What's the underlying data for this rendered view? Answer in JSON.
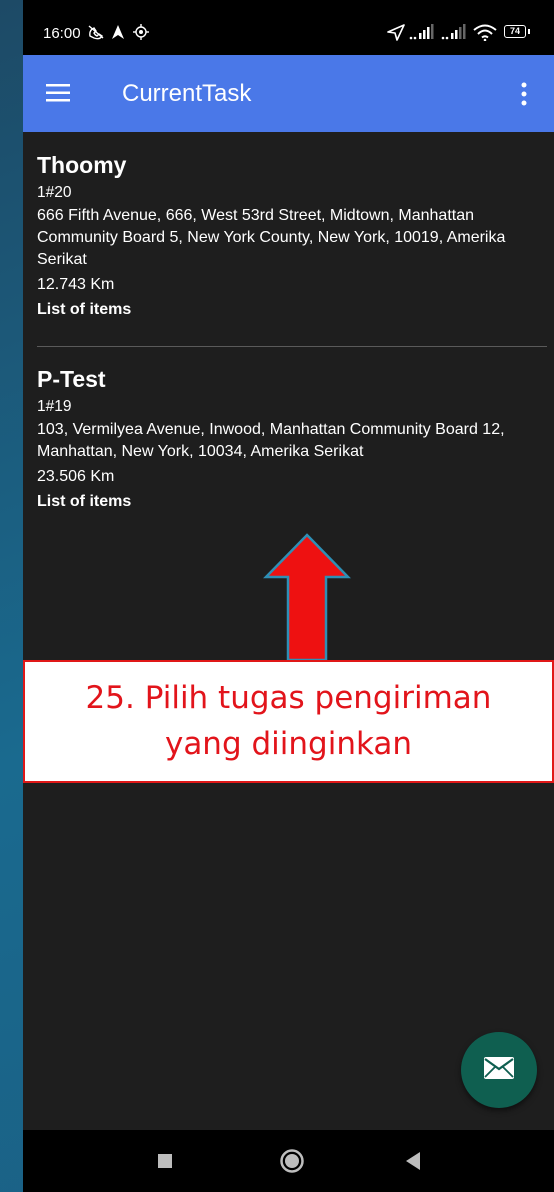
{
  "status_bar": {
    "time": "16:00",
    "battery": "74",
    "icons": [
      "muted-call-icon",
      "navigation-icon",
      "location-icon",
      "location-arrow-icon",
      "signal-icon",
      "signal-icon",
      "wifi-icon",
      "battery-icon"
    ]
  },
  "app_bar": {
    "title": "CurrentTask",
    "color": "#4a78e8",
    "icons": [
      "menu-icon",
      "overflow-menu-icon"
    ]
  },
  "tasks": [
    {
      "name": "Thoomy",
      "id": "1#20",
      "address": "666 Fifth Avenue, 666, West 53rd Street, Midtown, Manhattan Community Board 5, New York County, New York, 10019, Amerika Serikat",
      "distance": "12.743 Km",
      "items_label": "List of items"
    },
    {
      "name": "P-Test",
      "id": "1#19",
      "address": "103, Vermilyea Avenue, Inwood, Manhattan Community Board 12, Manhattan, New York, 10034, Amerika Serikat",
      "distance": "23.506 Km",
      "items_label": "List of items"
    }
  ],
  "caption": {
    "line1": "25. Pilih tugas pengiriman",
    "line2": "yang diinginkan",
    "color": "#e2141b"
  },
  "fab": {
    "icon": "mail-icon",
    "color": "#0f5f50"
  },
  "nav_bar": {
    "icons": [
      "recents-square-icon",
      "home-circle-icon",
      "back-triangle-icon"
    ]
  }
}
